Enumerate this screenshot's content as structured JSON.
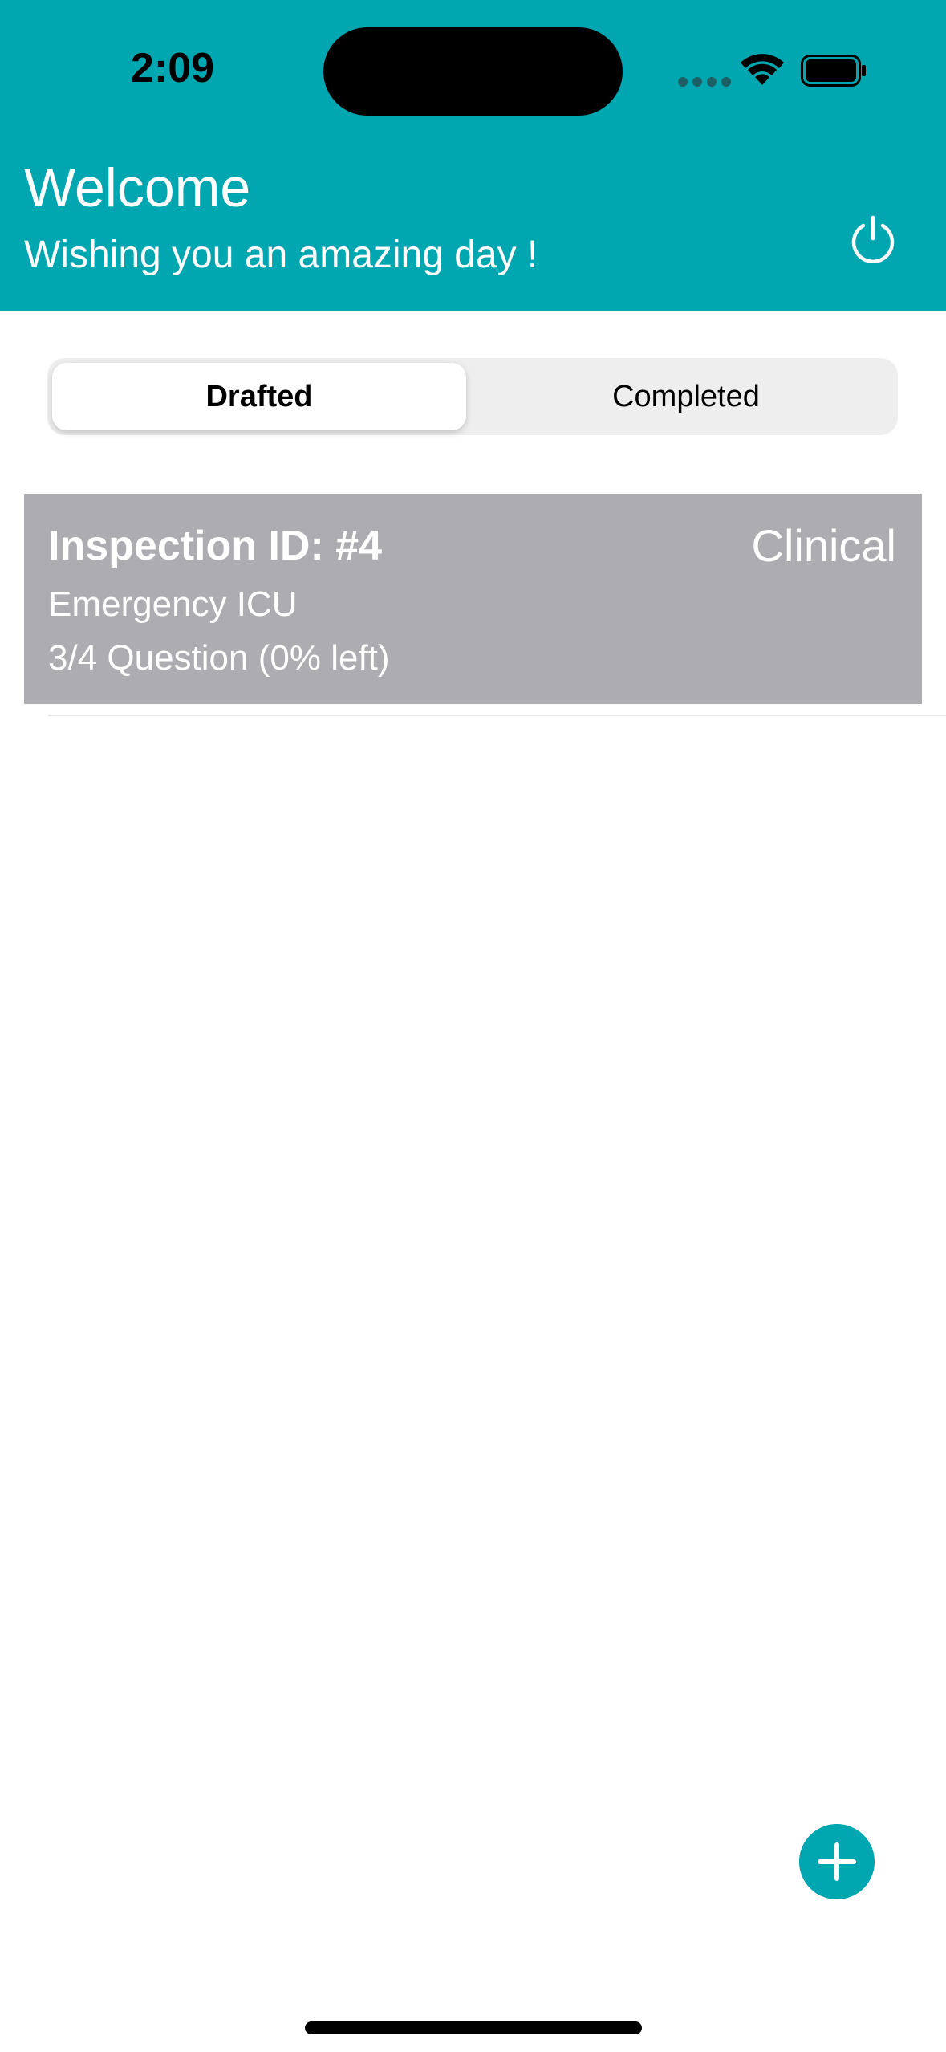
{
  "status_bar": {
    "time": "2:09",
    "wifi_icon": "wifi-icon",
    "battery_icon": "battery-full-icon"
  },
  "header": {
    "title": "Welcome",
    "subtitle": "Wishing you an amazing day !",
    "power_icon": "power-icon"
  },
  "segments": {
    "drafted_label": "Drafted",
    "completed_label": "Completed",
    "selected": "Drafted"
  },
  "inspections": [
    {
      "id_label": "Inspection ID: #4",
      "type": "Clinical",
      "department": "Emergency ICU",
      "progress": "3/4 Question (0% left)"
    }
  ],
  "fab": {
    "icon": "plus-icon"
  },
  "colors": {
    "accent": "#00a6b0",
    "card_background": "#acacb1",
    "segment_background": "#eeeeee"
  }
}
